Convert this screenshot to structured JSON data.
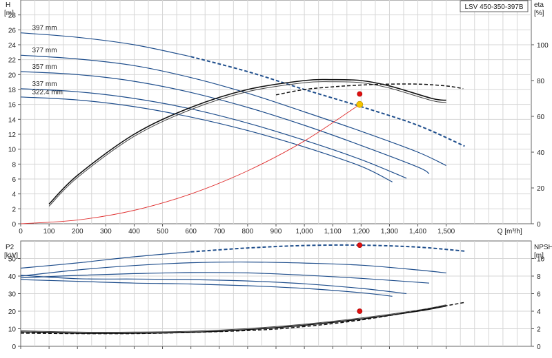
{
  "legend_box": "LSV 450-350-397B",
  "colors": {
    "curve": "#1f4e8c",
    "eff": "#111111",
    "system": "#e03030",
    "duty_yellow": "#f5c400",
    "duty_red": "#e01010",
    "grid": "#d6d6d6"
  },
  "chart_data": [
    {
      "type": "line",
      "panel": "head",
      "ylabel_left": "H",
      "yunit_left": "[m]",
      "ylabel_right": "eta",
      "yunit_right": "[%]",
      "xlabel": "Q [m³/h]",
      "xlim": [
        0,
        1800
      ],
      "ylim": [
        0,
        30
      ],
      "x_ticks": [
        0,
        100,
        200,
        300,
        400,
        500,
        600,
        700,
        800,
        900,
        1000,
        1100,
        1200,
        1300,
        1400,
        1500
      ],
      "x_tick_labels": [
        "0",
        "100",
        "200",
        "300",
        "400",
        "500",
        "600",
        "700",
        "800",
        "900",
        "1,000",
        "1,100",
        "1,200",
        "1,300",
        "1,400",
        "1,500"
      ],
      "y_ticks": [
        0,
        2,
        4,
        6,
        8,
        10,
        12,
        14,
        16,
        18,
        20,
        22,
        24,
        26,
        28
      ],
      "y_right_ticks": [
        0,
        20,
        40,
        60,
        80,
        100
      ],
      "y_right_range": [
        0,
        125
      ],
      "grid": true,
      "series": [
        {
          "name": "397 mm",
          "role": "head",
          "points": [
            [
              0,
              25.6
            ],
            [
              200,
              25.0
            ],
            [
              400,
              24.0
            ],
            [
              600,
              22.4
            ],
            [
              800,
              20.4
            ],
            [
              1000,
              18.0
            ],
            [
              1200,
              15.7
            ],
            [
              1400,
              13.2
            ],
            [
              1565,
              10.4
            ]
          ],
          "dashed_from": 600
        },
        {
          "name": "377 mm",
          "role": "head",
          "points": [
            [
              0,
              22.6
            ],
            [
              200,
              22.1
            ],
            [
              400,
              21.2
            ],
            [
              600,
              19.6
            ],
            [
              800,
              17.5
            ],
            [
              1000,
              15.0
            ],
            [
              1200,
              12.4
            ],
            [
              1400,
              9.6
            ],
            [
              1500,
              7.8
            ]
          ]
        },
        {
          "name": "357 mm",
          "role": "head",
          "points": [
            [
              0,
              20.4
            ],
            [
              200,
              20.0
            ],
            [
              400,
              19.1
            ],
            [
              600,
              17.6
            ],
            [
              800,
              15.6
            ],
            [
              1000,
              13.2
            ],
            [
              1200,
              10.5
            ],
            [
              1400,
              7.6
            ],
            [
              1440,
              6.7
            ]
          ]
        },
        {
          "name": "337 mm",
          "role": "head",
          "points": [
            [
              0,
              18.1
            ],
            [
              200,
              17.7
            ],
            [
              400,
              16.8
            ],
            [
              600,
              15.4
            ],
            [
              800,
              13.5
            ],
            [
              1000,
              11.2
            ],
            [
              1200,
              8.6
            ],
            [
              1360,
              6.1
            ]
          ]
        },
        {
          "name": "322.4 mm",
          "role": "head",
          "points": [
            [
              0,
              17.0
            ],
            [
              200,
              16.6
            ],
            [
              400,
              15.7
            ],
            [
              600,
              14.3
            ],
            [
              800,
              12.5
            ],
            [
              1000,
              10.3
            ],
            [
              1200,
              7.7
            ],
            [
              1310,
              5.6
            ]
          ]
        },
        {
          "name": "",
          "role": "efficiency",
          "points": [
            [
              100,
              11
            ],
            [
              200,
              27
            ],
            [
              400,
              50
            ],
            [
              600,
              65
            ],
            [
              800,
              75
            ],
            [
              1000,
              80
            ],
            [
              1100,
              80.5
            ],
            [
              1200,
              80
            ],
            [
              1300,
              77
            ],
            [
              1450,
              70
            ],
            [
              1500,
              69
            ]
          ]
        },
        {
          "name": "",
          "role": "efficiency_dashed",
          "points": [
            [
              900,
              72
            ],
            [
              1000,
              75
            ],
            [
              1100,
              76.5
            ],
            [
              1200,
              77.5
            ],
            [
              1300,
              78
            ],
            [
              1400,
              78
            ],
            [
              1500,
              77
            ],
            [
              1560,
              75.5
            ]
          ]
        },
        {
          "name": "",
          "role": "system",
          "points": [
            [
              0,
              0
            ],
            [
              200,
              0.5
            ],
            [
              400,
              1.8
            ],
            [
              600,
              4.0
            ],
            [
              800,
              7.1
            ],
            [
              1000,
              11.1
            ],
            [
              1195,
              16.0
            ]
          ]
        }
      ],
      "duty_points": [
        {
          "x": 1195,
          "y": 16.0,
          "color": "yellow"
        },
        {
          "x": 1195,
          "y": 72.5,
          "axis": "right",
          "color": "red"
        }
      ]
    },
    {
      "type": "line",
      "panel": "power",
      "ylabel_left": "P2",
      "yunit_left": "[kW]",
      "ylabel_right": "NPSH",
      "yunit_right": "[m]",
      "xlim": [
        0,
        1800
      ],
      "ylim": [
        0,
        60
      ],
      "y_ticks": [
        0,
        10,
        20,
        30,
        40,
        50
      ],
      "y_right_ticks": [
        0,
        2,
        4,
        6,
        8,
        10
      ],
      "y_right_range": [
        0,
        12
      ],
      "grid": true,
      "series": [
        {
          "name": "397 mm",
          "role": "power",
          "points": [
            [
              0,
              44.5
            ],
            [
              200,
              47.5
            ],
            [
              400,
              51
            ],
            [
              600,
              53.8
            ],
            [
              800,
              56
            ],
            [
              1000,
              57.4
            ],
            [
              1200,
              57.6
            ],
            [
              1400,
              56.5
            ],
            [
              1565,
              54.2
            ]
          ],
          "dashed_from": 600
        },
        {
          "name": "377 mm",
          "role": "power",
          "points": [
            [
              0,
              40
            ],
            [
              200,
              43.5
            ],
            [
              400,
              46
            ],
            [
              600,
              47.6
            ],
            [
              800,
              48
            ],
            [
              1000,
              47.4
            ],
            [
              1200,
              46.2
            ],
            [
              1400,
              43.5
            ],
            [
              1500,
              41.8
            ]
          ]
        },
        {
          "name": "357 mm",
          "role": "power",
          "points": [
            [
              0,
              39
            ],
            [
              200,
              40.4
            ],
            [
              400,
              41.4
            ],
            [
              600,
              42
            ],
            [
              800,
              41.8
            ],
            [
              1000,
              40.5
            ],
            [
              1200,
              38.7
            ],
            [
              1440,
              36
            ]
          ]
        },
        {
          "name": "337 mm",
          "role": "power",
          "points": [
            [
              0,
              40.5
            ],
            [
              200,
              38.5
            ],
            [
              400,
              38.3
            ],
            [
              600,
              38
            ],
            [
              800,
              37.2
            ],
            [
              1000,
              35.6
            ],
            [
              1200,
              33
            ],
            [
              1360,
              30
            ]
          ]
        },
        {
          "name": "322.4 mm",
          "role": "power",
          "points": [
            [
              0,
              38
            ],
            [
              200,
              37
            ],
            [
              400,
              36
            ],
            [
              600,
              35.5
            ],
            [
              800,
              34.5
            ],
            [
              1000,
              33
            ],
            [
              1200,
              30.5
            ],
            [
              1310,
              28.5
            ]
          ]
        },
        {
          "name": "",
          "role": "npsh",
          "points": [
            [
              0,
              1.65
            ],
            [
              200,
              1.5
            ],
            [
              400,
              1.5
            ],
            [
              600,
              1.6
            ],
            [
              800,
              1.9
            ],
            [
              1000,
              2.4
            ],
            [
              1200,
              3.1
            ],
            [
              1400,
              4.0
            ],
            [
              1500,
              4.6
            ]
          ]
        },
        {
          "name": "",
          "role": "npsh_dashed",
          "points": [
            [
              0,
              1.5
            ],
            [
              400,
              1.45
            ],
            [
              800,
              1.8
            ],
            [
              1000,
              2.25
            ],
            [
              1200,
              3.0
            ],
            [
              1400,
              4.05
            ],
            [
              1565,
              5.0
            ]
          ]
        }
      ],
      "duty_points": [
        {
          "x": 1195,
          "y": 57.6,
          "color": "red"
        },
        {
          "x": 1195,
          "y": 4.0,
          "axis": "right",
          "color": "red"
        }
      ]
    }
  ]
}
